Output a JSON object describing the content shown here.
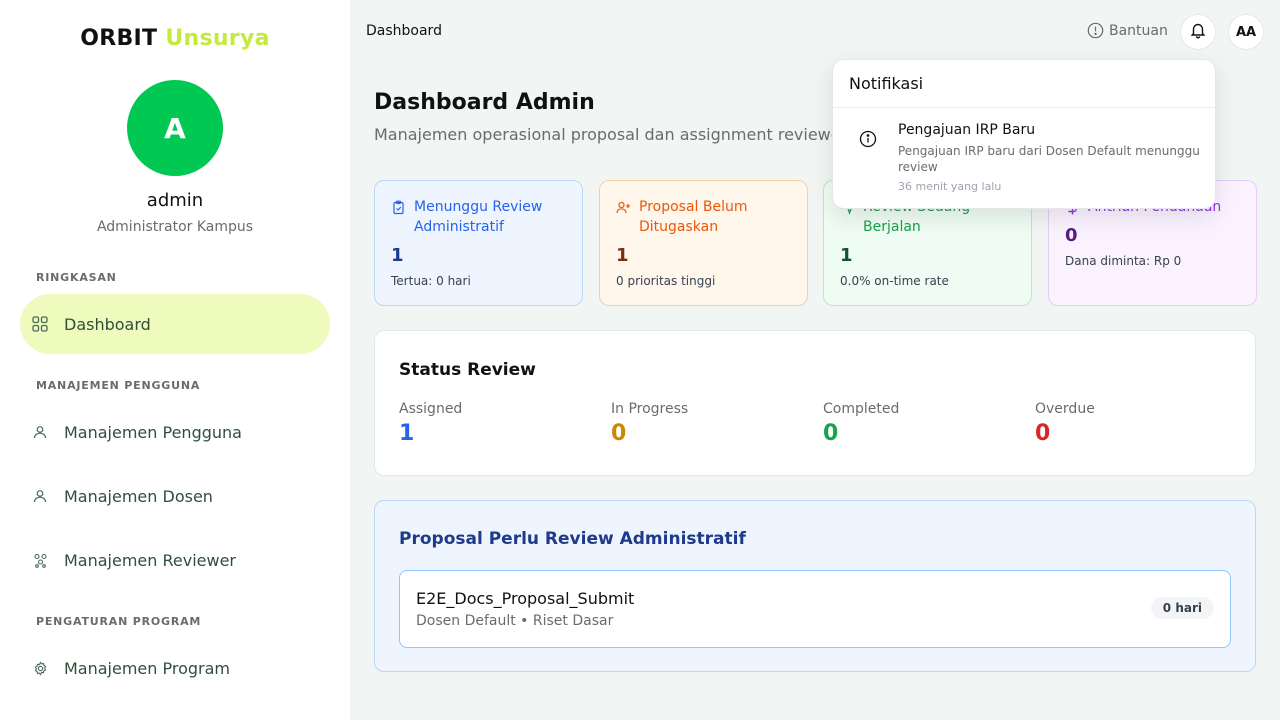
{
  "sidebar": {
    "brand": {
      "part1": "ORBIT",
      "part2": "Unsurya"
    },
    "user": {
      "initial": "A",
      "name": "admin",
      "role": "Administrator Kampus"
    },
    "sections": [
      {
        "label": "RINGKASAN"
      },
      {
        "label": "MANAJEMEN PENGGUNA"
      },
      {
        "label": "PENGATURAN PROGRAM"
      }
    ],
    "items": [
      {
        "label": "Dashboard",
        "icon": "grid-icon",
        "active": true
      },
      {
        "label": "Manajemen Pengguna",
        "icon": "user-icon"
      },
      {
        "label": "Manajemen Dosen",
        "icon": "user-icon"
      },
      {
        "label": "Manajemen Reviewer",
        "icon": "people-icon"
      },
      {
        "label": "Manajemen Program",
        "icon": "gear-icon"
      }
    ]
  },
  "header": {
    "breadcrumb": "Dashboard",
    "help_label": "Bantuan",
    "avatar_initials": "AA"
  },
  "main": {
    "title": "Dashboard Admin",
    "subtitle": "Manajemen operasional proposal dan assignment reviewer",
    "stats": [
      {
        "label": "Menunggu Review Administratif",
        "value": "1",
        "note": "Tertua: 0 hari",
        "icon": "clipboard-icon",
        "color": "#2563eb"
      },
      {
        "label": "Proposal Belum Ditugaskan",
        "value": "1",
        "note": "0 prioritas tinggi",
        "icon": "user-plus-icon",
        "color": "#ea580c"
      },
      {
        "label": "Review Sedang Berjalan",
        "value": "1",
        "note": "0.0% on-time rate",
        "icon": "activity-icon",
        "color": "#16a34a"
      },
      {
        "label": "Antrian Pendanaan",
        "value": "0",
        "note": "Dana diminta: Rp 0",
        "icon": "dollar-icon",
        "color": "#9333ea"
      }
    ],
    "status_review": {
      "title": "Status Review",
      "items": [
        {
          "label": "Assigned",
          "value": "1",
          "color": "#2563eb"
        },
        {
          "label": "In Progress",
          "value": "0",
          "color": "#ca8a04"
        },
        {
          "label": "Completed",
          "value": "0",
          "color": "#16a34a"
        },
        {
          "label": "Overdue",
          "value": "0",
          "color": "#dc2626"
        }
      ]
    },
    "proposals": {
      "title": "Proposal Perlu Review Administratif",
      "items": [
        {
          "name": "E2E_Docs_Proposal_Submit",
          "meta": "Dosen Default • Riset Dasar",
          "badge": "0 hari"
        }
      ]
    }
  },
  "notifications": {
    "title": "Notifikasi",
    "items": [
      {
        "title": "Pengajuan IRP Baru",
        "body": "Pengajuan IRP baru dari Dosen Default menunggu review",
        "time": "36 menit yang lalu",
        "icon": "info-icon"
      }
    ]
  }
}
